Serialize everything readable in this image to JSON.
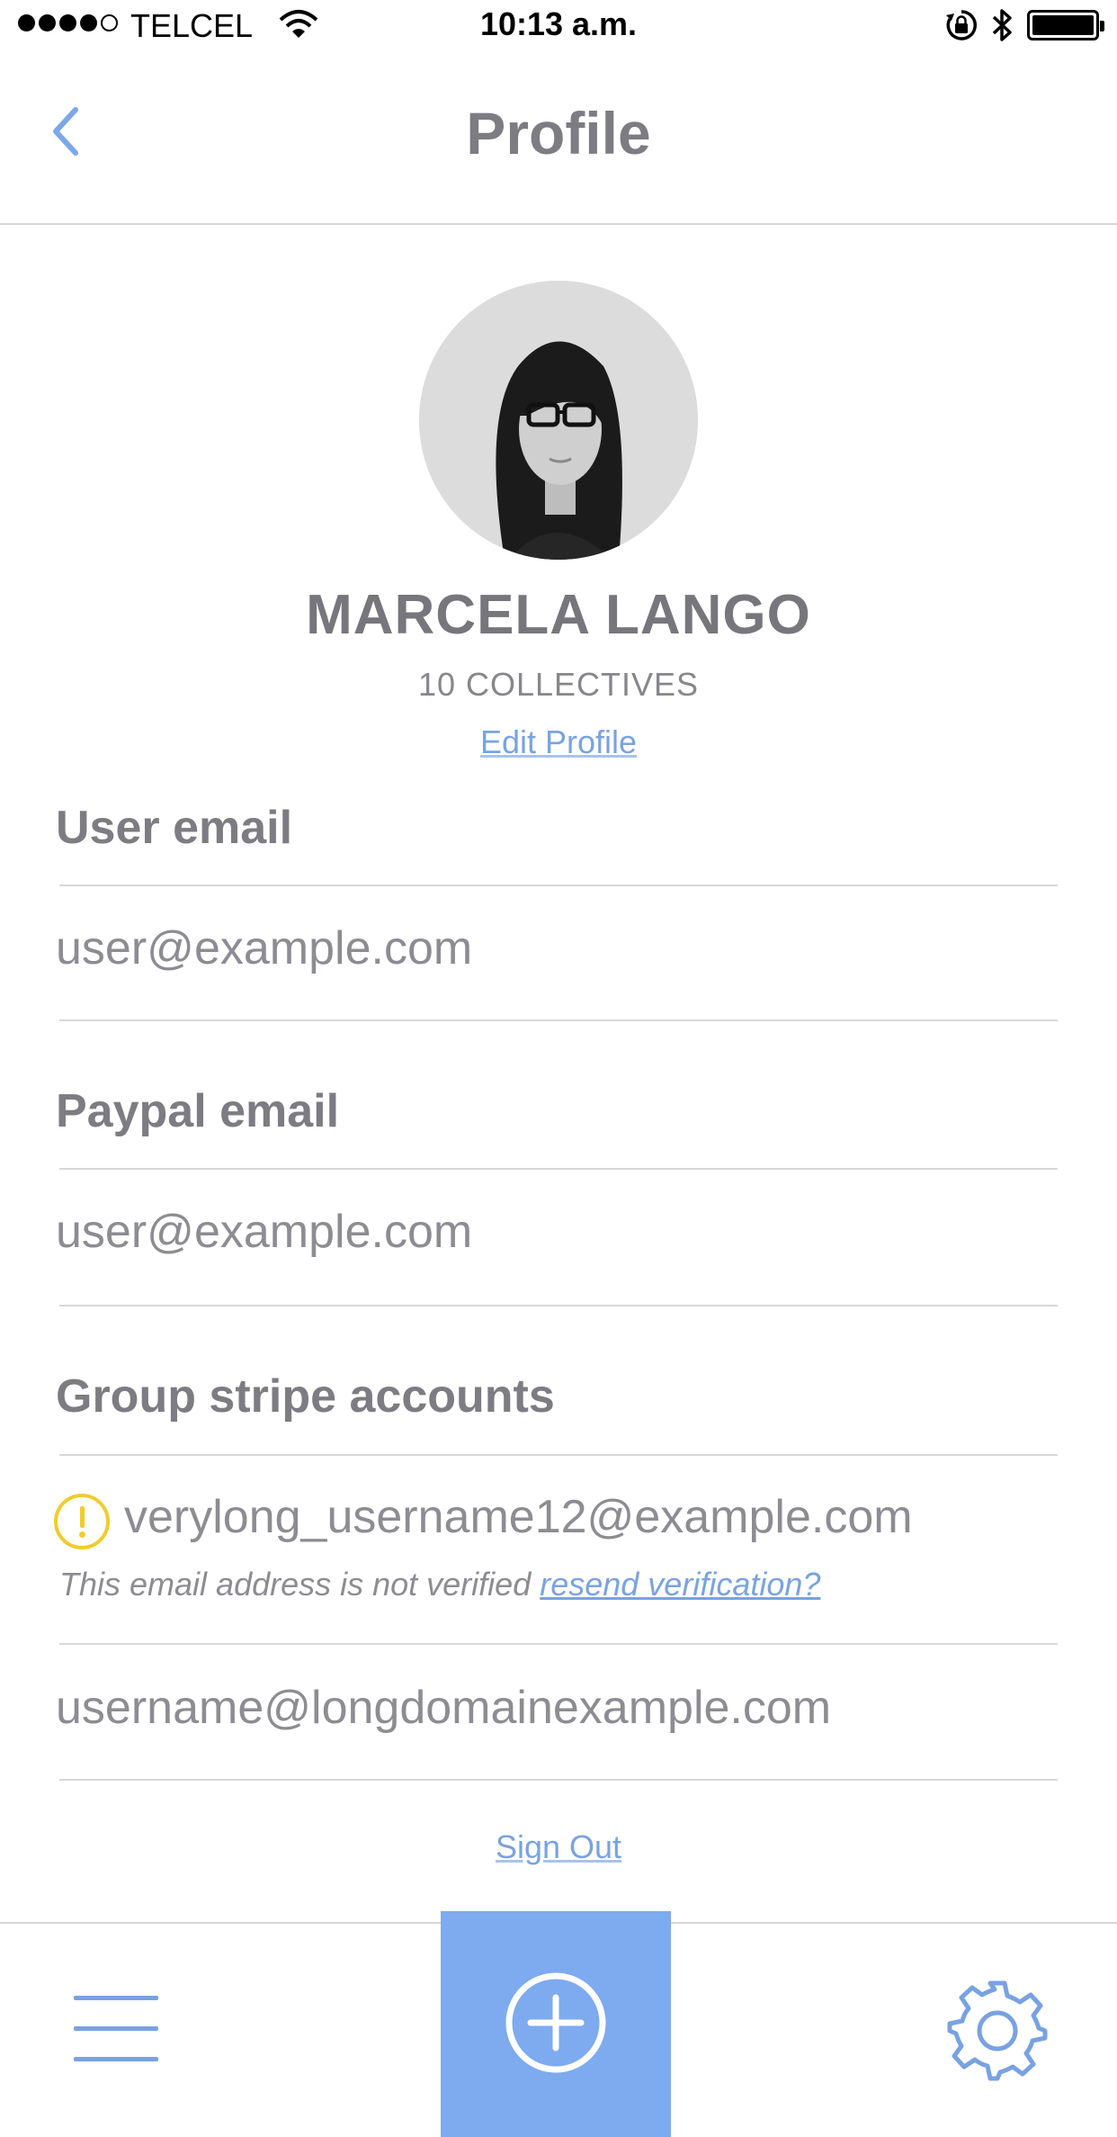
{
  "status_bar": {
    "carrier": "TELCEL",
    "time": "10:13 a.m.",
    "signal_bars_filled": 4,
    "signal_bars_total": 5
  },
  "nav": {
    "title": "Profile",
    "back_icon": "chevron-left-icon"
  },
  "profile": {
    "name": "MARCELA LANGO",
    "collectives": "10 COLLECTIVES",
    "edit_label": "Edit Profile"
  },
  "user_email": {
    "label": "User email",
    "value": "user@example.com"
  },
  "paypal_email": {
    "label": "Paypal email",
    "value": "user@example.com"
  },
  "stripe": {
    "label": "Group stripe accounts",
    "accounts": [
      {
        "email": "verylong_username12@example.com",
        "warning_icon": "exclamation-circle-icon",
        "note": "This email address is not verified",
        "resend_label": "resend verification?"
      },
      {
        "email": "username@longdomainexample.com"
      }
    ]
  },
  "sign_out_label": "Sign Out",
  "tabbar": {
    "menu_icon": "hamburger-menu-icon",
    "add_icon": "plus-circle-icon",
    "settings_icon": "gear-icon"
  },
  "colors": {
    "accent": "#7eaaf0",
    "link": "#7aa3e0",
    "warning": "#f0cc2e",
    "text": "#7c7c82"
  }
}
